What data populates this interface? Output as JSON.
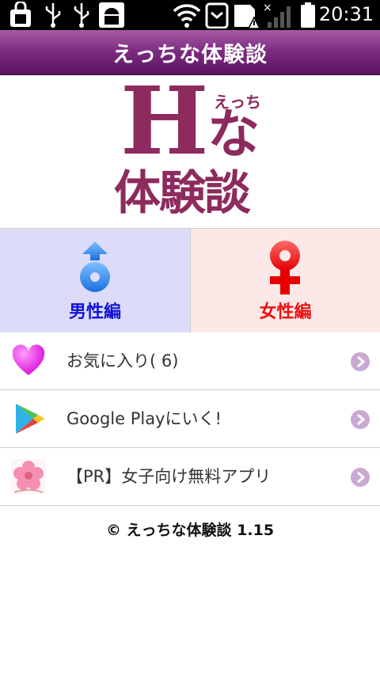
{
  "status_bar": {
    "time": "20:31",
    "icons": [
      "shopping-bag-icon",
      "usb-icon",
      "usb-icon",
      "android-debug-icon",
      "wifi-icon",
      "battery-saver-icon",
      "sd-card-alert-icon",
      "signal-icon",
      "battery-icon"
    ]
  },
  "header": {
    "title": "えっちな体験談"
  },
  "logo": {
    "h": "H",
    "ecchi": "えっち",
    "na": "な",
    "taiken": "体験談"
  },
  "gender": {
    "male_label": "男性編",
    "female_label": "女性編",
    "male_color": "#1212d8",
    "female_color": "#ee1111"
  },
  "menu": {
    "items": [
      {
        "label": "お気に入り( 6)",
        "icon": "heart-icon"
      },
      {
        "label": "Google Playにいく!",
        "icon": "google-play-icon"
      },
      {
        "label": "【PR】女子向け無料アプリ",
        "icon": "flower-icon"
      }
    ]
  },
  "footer": {
    "text": "© えっちな体験談  1.15"
  },
  "colors": {
    "accent": "#7a2a7e",
    "logo": "#8d2b5e"
  }
}
